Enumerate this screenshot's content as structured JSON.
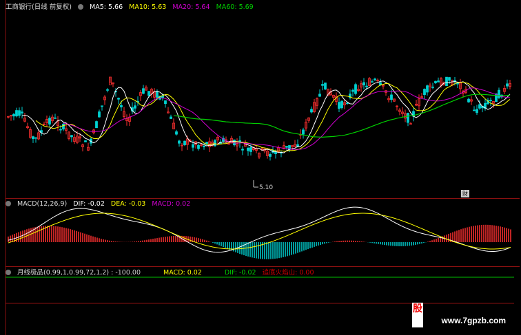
{
  "main_panel": {
    "title": "工商银行(日线 前复权)",
    "ma": [
      {
        "label": "MA5: 5.66",
        "color": "#ffffff"
      },
      {
        "label": "MA10: 5.63",
        "color": "#ffff00"
      },
      {
        "label": "MA20: 5.64",
        "color": "#d000d0"
      },
      {
        "label": "MA60: 5.69",
        "color": "#00d000"
      }
    ],
    "low_label": "5.10",
    "badge": "财"
  },
  "macd_panel": {
    "title": "MACD(12,26,9)",
    "items": [
      {
        "label": "DIF: -0.02",
        "color": "#ffffff"
      },
      {
        "label": "DEA: -0.03",
        "color": "#ffff00"
      },
      {
        "label": "MACD: 0.02",
        "color": "#d000d0"
      }
    ]
  },
  "ind_panel": {
    "title": "月线极品(0.99,1,0.99,72,1,2)",
    "items": [
      {
        "label": ": -100.00",
        "color": "#cccccc"
      },
      {
        "label": "MACD: 0.02",
        "color": "#ffff00"
      },
      {
        "label": "DIF: -0.02",
        "color": "#00d000"
      },
      {
        "label": "追底火焰山: 0.00",
        "color": "#d00000"
      }
    ]
  },
  "watermark": {
    "text": "www.7gpzb.com",
    "logo": "股"
  },
  "colors": {
    "up": "#ff3030",
    "down": "#00d0d0",
    "grid": "#8a1010"
  }
}
